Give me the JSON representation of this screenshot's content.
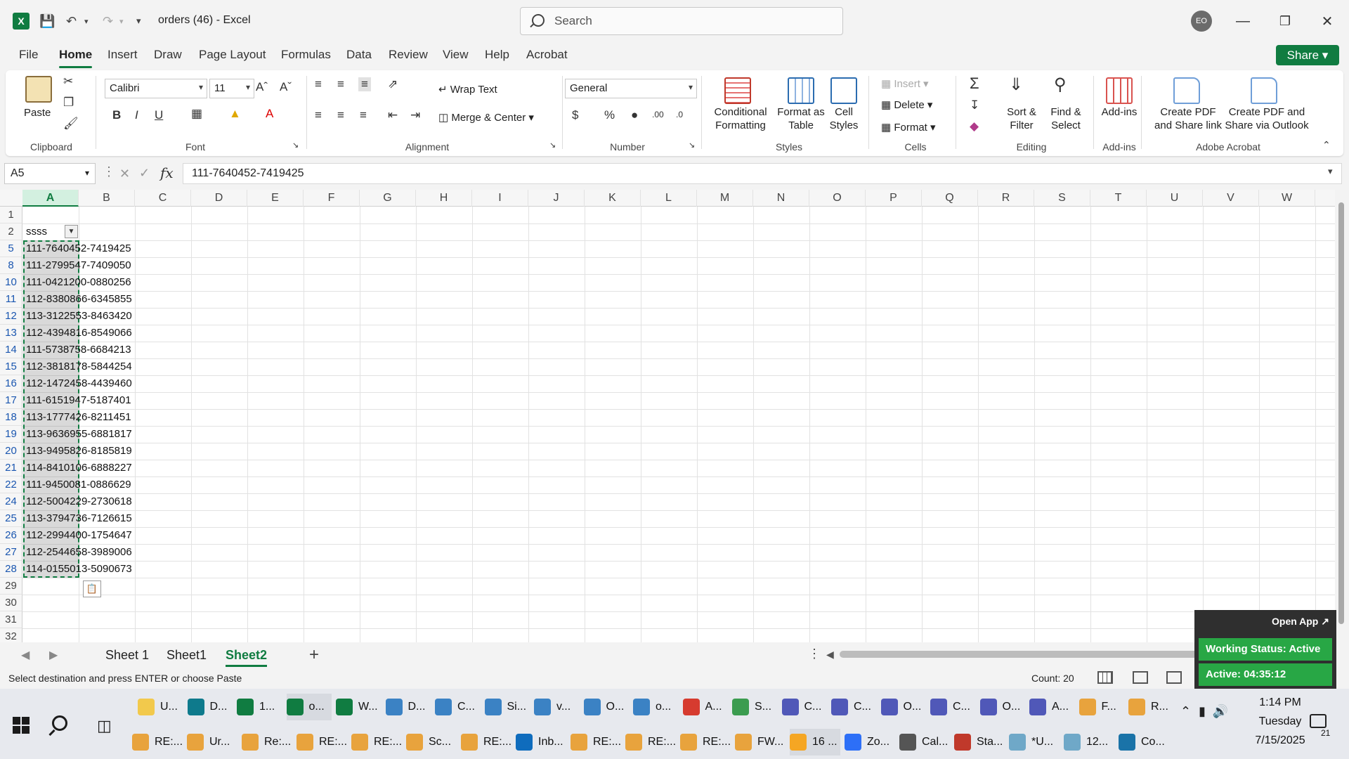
{
  "window": {
    "title": "orders (46)  -  Excel",
    "search_placeholder": "Search",
    "user_initials": "EO",
    "share_label": "Share",
    "accent": "#107c41"
  },
  "menu": [
    "File",
    "Home",
    "Insert",
    "Draw",
    "Page Layout",
    "Formulas",
    "Data",
    "Review",
    "View",
    "Help",
    "Acrobat"
  ],
  "ribbon": {
    "clipboard": {
      "paste": "Paste",
      "label": "Clipboard"
    },
    "font": {
      "name": "Calibri",
      "size": "11",
      "label": "Font"
    },
    "alignment": {
      "wrap": "Wrap Text",
      "merge": "Merge & Center",
      "label": "Alignment"
    },
    "number": {
      "format": "General",
      "label": "Number"
    },
    "styles": {
      "conditional": [
        "Conditional",
        "Formatting"
      ],
      "format_table": [
        "Format as",
        "Table"
      ],
      "cell_styles": [
        "Cell",
        "Styles"
      ],
      "label": "Styles"
    },
    "cells": {
      "insert": "Insert",
      "delete": "Delete",
      "format": "Format",
      "label": "Cells"
    },
    "editing": {
      "sort": [
        "Sort &",
        "Filter"
      ],
      "find": [
        "Find &",
        "Select"
      ],
      "label": "Editing"
    },
    "addins": {
      "button": "Add-ins",
      "label": "Add-ins"
    },
    "acrobat": {
      "pdf_link": [
        "Create PDF",
        "and Share link"
      ],
      "pdf_outlook": [
        "Create PDF and",
        "Share via Outlook"
      ],
      "label": "Adobe Acrobat"
    }
  },
  "formula_bar": {
    "name_box": "A5",
    "fx": "fx",
    "formula": "111-7640452-7419425"
  },
  "grid": {
    "columns": [
      "A",
      "B",
      "C",
      "D",
      "E",
      "F",
      "G",
      "H",
      "I",
      "J",
      "K",
      "L",
      "M",
      "N",
      "O",
      "P",
      "Q",
      "R",
      "S",
      "T",
      "U",
      "V",
      "W"
    ],
    "header_cell": "ssss",
    "rows": [
      {
        "row": "1",
        "value": ""
      },
      {
        "row": "2",
        "value": "ssss"
      },
      {
        "row": "5",
        "value": "111-7640452-7419425"
      },
      {
        "row": "8",
        "value": "111-2799547-7409050"
      },
      {
        "row": "10",
        "value": "111-0421200-0880256"
      },
      {
        "row": "11",
        "value": "112-8380866-6345855"
      },
      {
        "row": "12",
        "value": "113-3122553-8463420"
      },
      {
        "row": "13",
        "value": "112-4394816-8549066"
      },
      {
        "row": "14",
        "value": "111-5738758-6684213"
      },
      {
        "row": "15",
        "value": "112-3818178-5844254"
      },
      {
        "row": "16",
        "value": "112-1472458-4439460"
      },
      {
        "row": "17",
        "value": "111-6151947-5187401"
      },
      {
        "row": "18",
        "value": "113-1777426-8211451"
      },
      {
        "row": "19",
        "value": "113-9636955-6881817"
      },
      {
        "row": "20",
        "value": "113-9495826-8185819"
      },
      {
        "row": "21",
        "value": "114-8410106-6888227"
      },
      {
        "row": "22",
        "value": "111-9450081-0886629"
      },
      {
        "row": "24",
        "value": "112-5004229-2730618"
      },
      {
        "row": "25",
        "value": "113-3794736-7126615"
      },
      {
        "row": "26",
        "value": "112-2994400-1754647"
      },
      {
        "row": "27",
        "value": "112-2544658-3989006"
      },
      {
        "row": "28",
        "value": "114-0155013-5090673"
      },
      {
        "row": "29",
        "value": ""
      },
      {
        "row": "30",
        "value": ""
      },
      {
        "row": "31",
        "value": ""
      },
      {
        "row": "32",
        "value": ""
      }
    ]
  },
  "sheets": {
    "tabs": [
      "Sheet 1",
      "Sheet1",
      "Sheet2"
    ],
    "active": "Sheet2",
    "add": "+"
  },
  "status": {
    "message": "Select destination and press ENTER or choose Paste",
    "count": "Count: 20"
  },
  "overlay": {
    "open_app": "Open App ↗",
    "working": "Working Status: Active",
    "active_time": "Active: 04:35:12"
  },
  "taskbar": {
    "row1": [
      {
        "label": "U...",
        "color": "#f2c94c"
      },
      {
        "label": "D...",
        "color": "#0e7a8c"
      },
      {
        "label": "1...",
        "color": "#107c41"
      },
      {
        "label": "o...",
        "color": "#107c41"
      },
      {
        "label": "W...",
        "color": "#107c41"
      },
      {
        "label": "D...",
        "color": "#3b82c4"
      },
      {
        "label": "C...",
        "color": "#3b82c4"
      },
      {
        "label": "Si...",
        "color": "#3b82c4"
      },
      {
        "label": "v...",
        "color": "#3b82c4"
      },
      {
        "label": "O...",
        "color": "#3b82c4"
      },
      {
        "label": "o...",
        "color": "#3b82c4"
      },
      {
        "label": "A...",
        "color": "#d63b2f"
      },
      {
        "label": "S...",
        "color": "#3b9c4f"
      },
      {
        "label": "C...",
        "color": "#5058b8"
      },
      {
        "label": "C...",
        "color": "#5058b8"
      },
      {
        "label": "O...",
        "color": "#5058b8"
      },
      {
        "label": "C...",
        "color": "#5058b8"
      },
      {
        "label": "O...",
        "color": "#5058b8"
      },
      {
        "label": "A...",
        "color": "#5058b8"
      },
      {
        "label": "F...",
        "color": "#e8a33d"
      },
      {
        "label": "R...",
        "color": "#e8a33d"
      }
    ],
    "row2": [
      {
        "label": "RE:...",
        "color": "#e8a33d"
      },
      {
        "label": "Ur...",
        "color": "#e8a33d"
      },
      {
        "label": "Re:...",
        "color": "#e8a33d"
      },
      {
        "label": "RE:...",
        "color": "#e8a33d"
      },
      {
        "label": "RE:...",
        "color": "#e8a33d"
      },
      {
        "label": "Sc...",
        "color": "#e8a33d"
      },
      {
        "label": "RE:...",
        "color": "#e8a33d"
      },
      {
        "label": "Inb...",
        "color": "#0f6cbd"
      },
      {
        "label": "RE:...",
        "color": "#e8a33d"
      },
      {
        "label": "RE:...",
        "color": "#e8a33d"
      },
      {
        "label": "RE:...",
        "color": "#e8a33d"
      },
      {
        "label": "FW...",
        "color": "#e8a33d"
      },
      {
        "label": "16 ...",
        "color": "#f5a623"
      },
      {
        "label": "Zo...",
        "color": "#2d6ff7"
      },
      {
        "label": "Cal...",
        "color": "#555555"
      },
      {
        "label": "Sta...",
        "color": "#c0392b"
      },
      {
        "label": "*U...",
        "color": "#6fa8c8"
      },
      {
        "label": "12...",
        "color": "#6fa8c8"
      },
      {
        "label": "Co...",
        "color": "#1a73a8"
      }
    ],
    "clock": {
      "time": "1:14 PM",
      "day": "Tuesday",
      "date": "7/15/2025"
    },
    "notifications": "21"
  }
}
